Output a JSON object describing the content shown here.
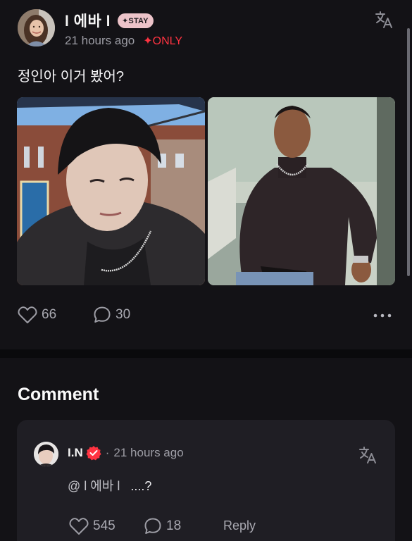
{
  "post": {
    "author": {
      "name": "l 에바 l",
      "badge": "✦STAY",
      "avatar": "profile-photo"
    },
    "timestamp": "21 hours ago",
    "visibility": "✦ONLY",
    "text": "정인아 이거 봤어?",
    "photos": [
      "selfie-black-turtleneck-chain",
      "man-black-turtleneck-chain"
    ],
    "likes": "66",
    "comments": "30",
    "icons": {
      "translate": "translate-icon",
      "like": "heart-outline-icon",
      "comment": "speech-bubble-icon",
      "more": "more-dots-icon"
    }
  },
  "comments_section": {
    "heading": "Comment",
    "items": [
      {
        "author": "I.N",
        "verified": true,
        "separator": "·",
        "timestamp": "21 hours ago",
        "mention": "@ l 에바 l",
        "text": "....?",
        "likes": "545",
        "replies": "18",
        "reply_label": "Reply"
      }
    ]
  },
  "colors": {
    "background": "#131216",
    "card": "#1f1e24",
    "accent_red": "#ff3341",
    "badge_pink": "#ecc3c9",
    "muted_text": "#9d9da5"
  }
}
